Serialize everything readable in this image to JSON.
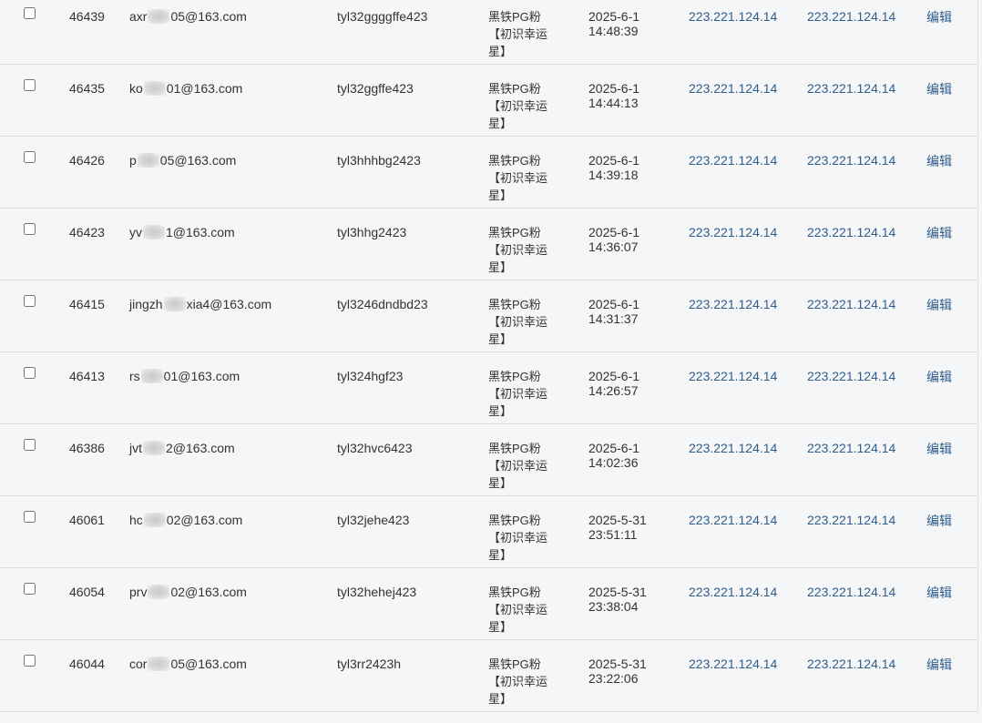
{
  "rows": [
    {
      "id": "46439",
      "email_pre": "axr",
      "email_post": "05@163.com",
      "nickname": "tyl32ggggffe423",
      "group_line1": "黑铁PG粉",
      "group_line2": "【初识幸运",
      "group_line3": "星】",
      "date": "2025-6-1",
      "time": "14:48:39",
      "ip_register": "223.221.124.14",
      "ip_login": "223.221.124.14",
      "action": "编辑"
    },
    {
      "id": "46435",
      "email_pre": "ko",
      "email_post": "01@163.com",
      "nickname": "tyl32ggffe423",
      "group_line1": "黑铁PG粉",
      "group_line2": "【初识幸运",
      "group_line3": "星】",
      "date": "2025-6-1",
      "time": "14:44:13",
      "ip_register": "223.221.124.14",
      "ip_login": "223.221.124.14",
      "action": "编辑"
    },
    {
      "id": "46426",
      "email_pre": "p",
      "email_post": "05@163.com",
      "nickname": "tyl3hhhbg2423",
      "group_line1": "黑铁PG粉",
      "group_line2": "【初识幸运",
      "group_line3": "星】",
      "date": "2025-6-1",
      "time": "14:39:18",
      "ip_register": "223.221.124.14",
      "ip_login": "223.221.124.14",
      "action": "编辑"
    },
    {
      "id": "46423",
      "email_pre": "yv",
      "email_post": "1@163.com",
      "nickname": "tyl3hhg2423",
      "group_line1": "黑铁PG粉",
      "group_line2": "【初识幸运",
      "group_line3": "星】",
      "date": "2025-6-1",
      "time": "14:36:07",
      "ip_register": "223.221.124.14",
      "ip_login": "223.221.124.14",
      "action": "编辑"
    },
    {
      "id": "46415",
      "email_pre": "jingzh",
      "email_post": "xia4@163.com",
      "nickname": "tyl3246dndbd23",
      "group_line1": "黑铁PG粉",
      "group_line2": "【初识幸运",
      "group_line3": "星】",
      "date": "2025-6-1",
      "time": "14:31:37",
      "ip_register": "223.221.124.14",
      "ip_login": "223.221.124.14",
      "action": "编辑"
    },
    {
      "id": "46413",
      "email_pre": "rs",
      "email_post": "01@163.com",
      "nickname": "tyl324hgf23",
      "group_line1": "黑铁PG粉",
      "group_line2": "【初识幸运",
      "group_line3": "星】",
      "date": "2025-6-1",
      "time": "14:26:57",
      "ip_register": "223.221.124.14",
      "ip_login": "223.221.124.14",
      "action": "编辑"
    },
    {
      "id": "46386",
      "email_pre": "jvt",
      "email_post": "2@163.com",
      "nickname": "tyl32hvc6423",
      "group_line1": "黑铁PG粉",
      "group_line2": "【初识幸运",
      "group_line3": "星】",
      "date": "2025-6-1",
      "time": "14:02:36",
      "ip_register": "223.221.124.14",
      "ip_login": "223.221.124.14",
      "action": "编辑"
    },
    {
      "id": "46061",
      "email_pre": "hc",
      "email_post": "02@163.com",
      "nickname": "tyl32jehe423",
      "group_line1": "黑铁PG粉",
      "group_line2": "【初识幸运",
      "group_line3": "星】",
      "date": "2025-5-31",
      "time": "23:51:11",
      "ip_register": "223.221.124.14",
      "ip_login": "223.221.124.14",
      "action": "编辑"
    },
    {
      "id": "46054",
      "email_pre": "prv",
      "email_post": "02@163.com",
      "nickname": "tyl32hehej423",
      "group_line1": "黑铁PG粉",
      "group_line2": "【初识幸运",
      "group_line3": "星】",
      "date": "2025-5-31",
      "time": "23:38:04",
      "ip_register": "223.221.124.14",
      "ip_login": "223.221.124.14",
      "action": "编辑"
    },
    {
      "id": "46044",
      "email_pre": "cor",
      "email_post": "05@163.com",
      "nickname": "tyl3rr2423h",
      "group_line1": "黑铁PG粉",
      "group_line2": "【初识幸运",
      "group_line3": "星】",
      "date": "2025-5-31",
      "time": "23:22:06",
      "ip_register": "223.221.124.14",
      "ip_login": "223.221.124.14",
      "action": "编辑"
    }
  ]
}
